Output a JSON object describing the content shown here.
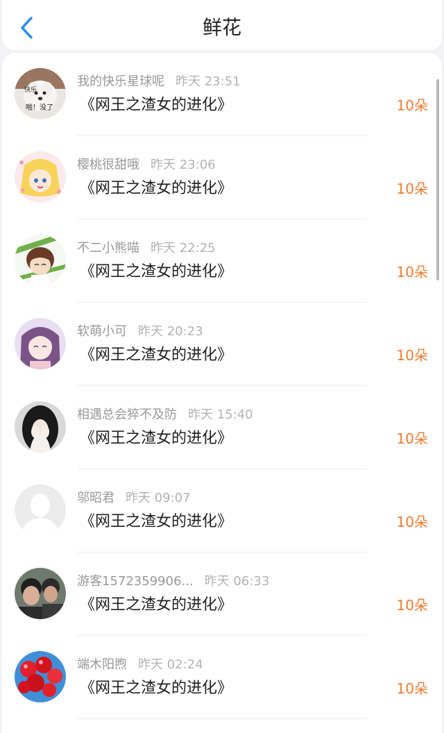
{
  "header": {
    "title": "鲜花",
    "back_icon": "chevron-left-icon",
    "accent": "#2e8ff0"
  },
  "list": {
    "count_color": "#f07b2d",
    "items": [
      {
        "user": "我的快乐星球呢",
        "time": "昨天 23:51",
        "book": "《网王之渣女的进化》",
        "count": "10朵",
        "avatar": "meme-dog-avatar",
        "avatar_text_1": "快乐",
        "avatar_text_2": "啪！没了"
      },
      {
        "user": "樱桃很甜哦",
        "time": "昨天 23:06",
        "book": "《网王之渣女的进化》",
        "count": "10朵",
        "avatar": "anime-sailor-girl-avatar"
      },
      {
        "user": "不二小熊喵",
        "time": "昨天 22:25",
        "book": "《网王之渣女的进化》",
        "count": "10朵",
        "avatar": "anime-boy-avatar"
      },
      {
        "user": "软萌小可",
        "time": "昨天 20:23",
        "book": "《网王之渣女的进化》",
        "count": "10朵",
        "avatar": "anime-purple-girl-avatar"
      },
      {
        "user": "相遇总会猝不及防",
        "time": "昨天 15:40",
        "book": "《网王之渣女的进化》",
        "count": "10朵",
        "avatar": "girl-covering-face-avatar"
      },
      {
        "user": "邬昭君",
        "time": "昨天 09:07",
        "book": "《网王之渣女的进化》",
        "count": "10朵",
        "avatar": "default-user-avatar"
      },
      {
        "user": "游客1572359906...",
        "time": "昨天 06:33",
        "book": "《网王之渣女的进化》",
        "count": "10朵",
        "avatar": "two-boys-photo-avatar"
      },
      {
        "user": "端木阳煦",
        "time": "昨天 02:24",
        "book": "《网王之渣女的进化》",
        "count": "10朵",
        "avatar": "red-balloons-avatar"
      }
    ]
  }
}
